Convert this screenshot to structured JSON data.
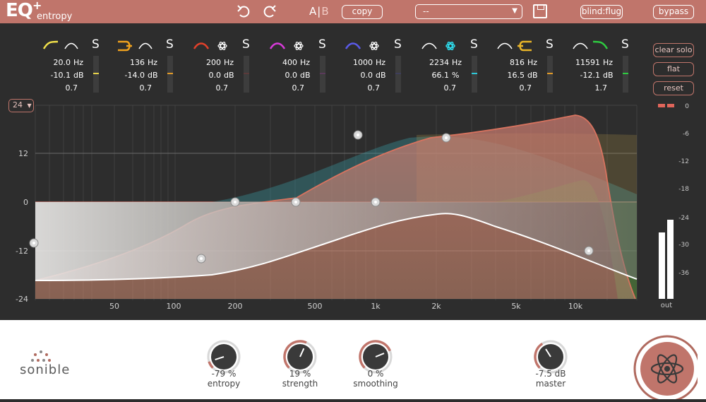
{
  "app": {
    "logo": "EQ",
    "logo_plus": "+",
    "product": "entropy",
    "brand": "sonible"
  },
  "toolbar": {
    "undo_icon": "undo-icon",
    "redo_icon": "redo-icon",
    "ab_a": "A",
    "ab_b": "B",
    "copy_label": "copy",
    "preset_value": "--",
    "blind_label": "blind:flug",
    "bypass_label": "bypass"
  },
  "colors": {
    "accent": "#c0756b",
    "background": "#2d2d2d",
    "bottom": "#ffffff"
  },
  "bands": [
    {
      "freq": "20.0",
      "freq_unit": "Hz",
      "gain": "-10.1",
      "gain_unit": "dB",
      "q": "0.7",
      "solo": "S",
      "color": "#f2e14a",
      "tick": "#e6d24a",
      "shape": "low-shelf"
    },
    {
      "freq": "136",
      "freq_unit": "Hz",
      "gain": "-14.0",
      "gain_unit": "dB",
      "q": "0.7",
      "solo": "S",
      "color": "#f0a21e",
      "tick": "#e09a28",
      "shape": "low-cut"
    },
    {
      "freq": "200",
      "freq_unit": "Hz",
      "gain": "0.0",
      "gain_unit": "dB",
      "q": "0.7",
      "solo": "S",
      "color": "#e0402a",
      "tick": "#5a3a3a",
      "shape": "bell-entropy"
    },
    {
      "freq": "400",
      "freq_unit": "Hz",
      "gain": "0.0",
      "gain_unit": "dB",
      "q": "0.7",
      "solo": "S",
      "color": "#d63ad8",
      "tick": "#5a3a5a",
      "shape": "bell-entropy"
    },
    {
      "freq": "1000",
      "freq_unit": "Hz",
      "gain": "0.0",
      "gain_unit": "dB",
      "q": "0.7",
      "solo": "S",
      "color": "#5a5ae8",
      "tick": "#3e3e5a",
      "shape": "bell-entropy"
    },
    {
      "freq": "2234",
      "freq_unit": "Hz",
      "gain": "66.1",
      "gain_unit": "%",
      "q": "0.7",
      "solo": "S",
      "color": "#2ed8e8",
      "tick": "#2ec8d8",
      "shape": "entropy-active"
    },
    {
      "freq": "816",
      "freq_unit": "Hz",
      "gain": "16.5",
      "gain_unit": "dB",
      "q": "0.7",
      "solo": "S",
      "color": "#e8b428",
      "tick": "#e09a28",
      "shape": "high-cut"
    },
    {
      "freq": "11591",
      "freq_unit": "Hz",
      "gain": "-12.1",
      "gain_unit": "dB",
      "q": "1.7",
      "solo": "S",
      "color": "#2ecc40",
      "tick": "#2ecc40",
      "shape": "high-shelf"
    }
  ],
  "side": {
    "clear_solo": "clear solo",
    "flat": "flat",
    "reset": "reset"
  },
  "range": {
    "value": "24",
    "caret": "▼"
  },
  "graph": {
    "gain_labels": [
      "12",
      "0",
      "-12",
      "-24"
    ],
    "freq_labels": [
      "50",
      "100",
      "200",
      "500",
      "1k",
      "2k",
      "5k",
      "10k"
    ],
    "out_scale": [
      "0",
      "-6",
      "-12",
      "-18",
      "-24",
      "-30",
      "-36"
    ],
    "out_label": "out"
  },
  "knobs": [
    {
      "value": "-79 %",
      "label": "entropy",
      "fraction": 0.1
    },
    {
      "value": "19 %",
      "label": "strength",
      "fraction": 0.59
    },
    {
      "value": "0 %",
      "label": "smoothing",
      "fraction": 0.75
    },
    {
      "value": "-7.5 dB",
      "label": "master",
      "fraction": 0.38
    }
  ],
  "master_button_icon": "atom-icon"
}
